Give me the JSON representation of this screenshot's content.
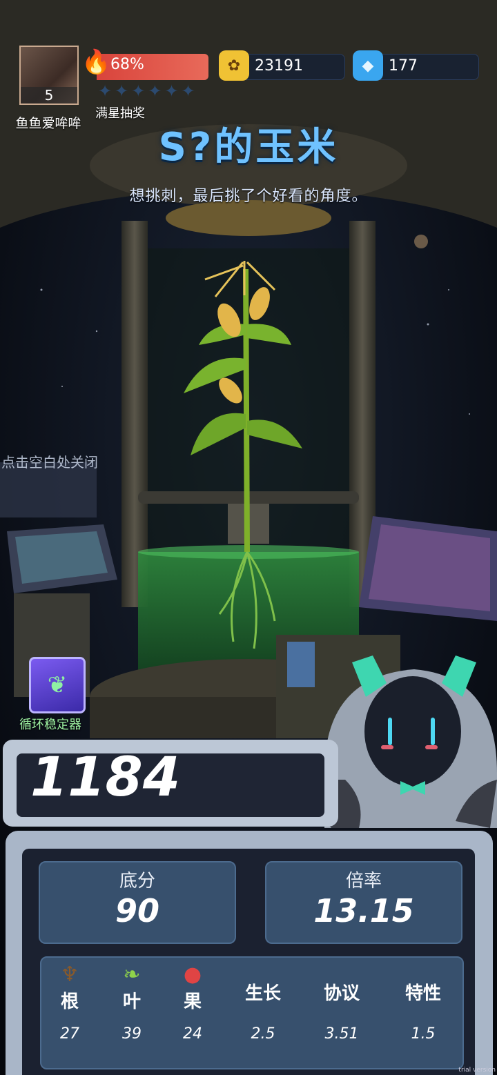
{
  "player": {
    "name": "鱼鱼爱哞哞",
    "level": "5"
  },
  "heat": {
    "percent": "68%",
    "stars_label": "满星抽奖",
    "stars_filled": 0,
    "stars_total": 6
  },
  "currencies": [
    {
      "icon": "gold-coin-icon",
      "value": "23191"
    },
    {
      "icon": "blue-gem-icon",
      "value": "177"
    }
  ],
  "plant": {
    "title": "S?的玉米",
    "description": "想挑刺，最后挑了个好看的角度。"
  },
  "hint": "点击空白处关闭",
  "stabilizer": {
    "label": "循环稳定器"
  },
  "result": {
    "total_score": "1184",
    "base_label": "底分",
    "base_value": "90",
    "multiplier_label": "倍率",
    "multiplier_value": "13.15"
  },
  "attributes": [
    {
      "label": "根",
      "value": "27",
      "icon": "root-icon"
    },
    {
      "label": "叶",
      "value": "39",
      "icon": "leaf-icon"
    },
    {
      "label": "果",
      "value": "24",
      "icon": "apple-icon"
    },
    {
      "label": "生长",
      "value": "2.5"
    },
    {
      "label": "协议",
      "value": "3.51"
    },
    {
      "label": "特性",
      "value": "1.5"
    }
  ],
  "watermark": "trial version",
  "colors": {
    "title": "#6fc2ff",
    "heat": "#d9443c",
    "panel": "#37506d",
    "stabilizer": "#9ef2a2"
  }
}
